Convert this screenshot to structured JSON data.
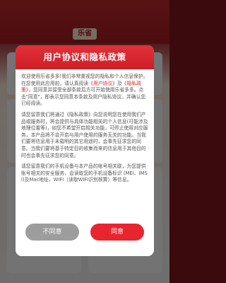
{
  "background": {
    "logo_text": "乐省"
  },
  "dialog": {
    "title": "用户协议和隐私政策",
    "p1_pre": "欢迎使用乐省多多!我们非常重视您的隐私和个人信息保护。在您使用此应用前，请认真阅读",
    "p1_link1": "《用户协议》",
    "p1_mid": "及",
    "p1_link2": "《隐私政策》",
    "p1_post": "，您同意并接受全部条款后方可开始使用乐省多多。点击\"同意\"，即表示您同意本条款及用户隐私协议，并确认您已经阅读。",
    "p2": "请您留意我们将通过《隐私政策》向您说明您在使用我们产品或服务时，将会提供与具体功能相关的个人信息(可能涉及地理位置等)，如您不希望开启相关功能，可停止使用对应服务，本产品将不会开启与用户使用的服务无关的功能。当我们要将信息用于未载明的其它用途时，会事先征求您的同意。当我们要将基于特定目的收集而来的信息用于其他目的时也会事先征求您的同意。",
    "p3": "请您留意我们的手机设备与本产品的账号相关联，为您提供账号相关的安全服务，会读取您的手机设备标识 (MEI、IMSI)及Mac地址，WIFI（读取WIFI识别核算）等信息。",
    "disagree_label": "不同意",
    "agree_label": "同意"
  },
  "colors": {
    "accent": "#e8252f",
    "header": "#cf1d26",
    "disagree": "#9d9d9d"
  }
}
